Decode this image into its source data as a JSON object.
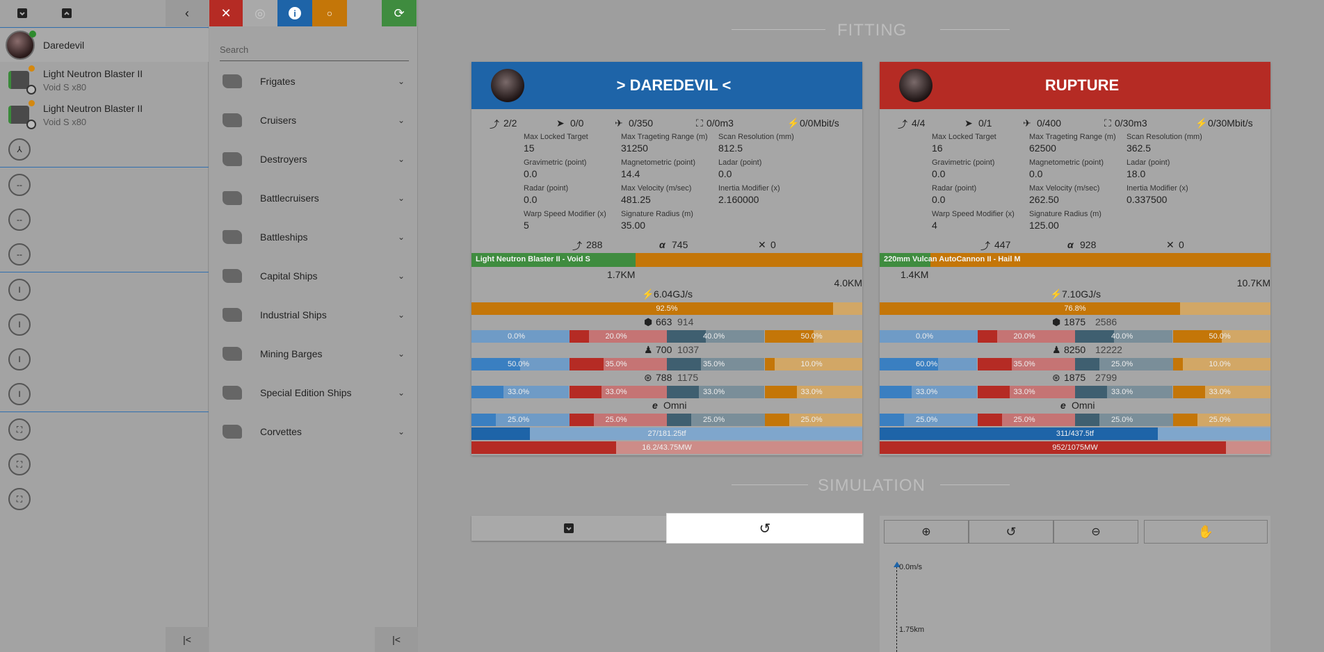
{
  "left": {
    "top_buttons": [
      "archive-down",
      "archive-up",
      "collapse"
    ],
    "ship": {
      "name": "Daredevil"
    },
    "modules": [
      {
        "name": "Light Neutron Blaster II",
        "ammo": "Void S x80"
      },
      {
        "name": "Light Neutron Blaster II",
        "ammo": "Void S x80"
      }
    ],
    "high_empty_symbol": "⅄",
    "mid_slots": [
      "--",
      "--",
      "--"
    ],
    "low_slots": [
      "I",
      "I",
      "I",
      "I"
    ],
    "rig_slots": [
      "⛶",
      "⛶",
      "⛶"
    ],
    "footer_icon": "|<"
  },
  "middle": {
    "search_placeholder": "Search",
    "categories": [
      "Frigates",
      "Cruisers",
      "Destroyers",
      "Battlecruisers",
      "Battleships",
      "Capital Ships",
      "Industrial Ships",
      "Mining Barges",
      "Special Edition Ships",
      "Corvettes"
    ],
    "footer_icon": "|<"
  },
  "main": {
    "fitting_title": "FITTING",
    "simulation_title": "SIMULATION",
    "colors": {
      "blue": "#1e64a8",
      "red": "#b52b24",
      "orange": "#c47608",
      "green": "#3f8c3f"
    },
    "ships": [
      {
        "title": "> DAREDEVIL <",
        "head_color": "#1e64a8",
        "resources": {
          "turrets": "2/2",
          "launchers": "0/0",
          "drone_bay": "0/350",
          "drone_cap": "0/0m3",
          "bandwidth": "0/0Mbit/s"
        },
        "stats": [
          {
            "label": "Max Locked Target",
            "value": "15"
          },
          {
            "label": "Max Trageting Range (m)",
            "value": "31250"
          },
          {
            "label": "Scan Resolution (mm)",
            "value": "812.5"
          },
          {
            "label": "Gravimetric (point)",
            "value": "0.0"
          },
          {
            "label": "Magnetometric (point)",
            "value": "14.4"
          },
          {
            "label": "Ladar (point)",
            "value": "0.0"
          },
          {
            "label": "Radar (point)",
            "value": "0.0"
          },
          {
            "label": "Max Velocity (m/sec)",
            "value": "481.25"
          },
          {
            "label": "Inertia Modifier (x)",
            "value": "2.160000"
          },
          {
            "label": "Warp Speed Modifier (x)",
            "value": "5"
          },
          {
            "label": "Signature Radius (m)",
            "value": "35.00"
          }
        ],
        "dps": {
          "weapon": "288",
          "alpha": "745",
          "other": "0"
        },
        "weapon_bar": {
          "label": "Light Neutron Blaster II - Void S",
          "fraction": 0.42
        },
        "optimal": "1.7KM",
        "falloff": "4.0KM",
        "cap": {
          "rate": "6.04GJ/s",
          "pct": "92.5%",
          "fraction": 0.925
        },
        "shield": {
          "hp": "663",
          "ehp": "914",
          "resists": [
            "0.0%",
            "20.0%",
            "40.0%",
            "50.0%"
          ]
        },
        "armor": {
          "hp": "700",
          "ehp": "1037",
          "resists": [
            "50.0%",
            "35.0%",
            "35.0%",
            "10.0%"
          ]
        },
        "hull": {
          "hp": "788",
          "ehp": "1175",
          "resists": [
            "33.0%",
            "33.0%",
            "33.0%",
            "33.0%"
          ]
        },
        "profile": {
          "label": "Omni",
          "resists": [
            "25.0%",
            "25.0%",
            "25.0%",
            "25.0%"
          ]
        },
        "cpu": {
          "label": "27/181.25tf",
          "fraction": 0.149
        },
        "power": {
          "label": "16.2/43.75MW",
          "fraction": 0.37
        }
      },
      {
        "title": "RUPTURE",
        "head_color": "#b52b24",
        "resources": {
          "turrets": "4/4",
          "launchers": "0/1",
          "drone_bay": "0/400",
          "drone_cap": "0/30m3",
          "bandwidth": "0/30Mbit/s"
        },
        "stats": [
          {
            "label": "Max Locked Target",
            "value": "16"
          },
          {
            "label": "Max Trageting Range (m)",
            "value": "62500"
          },
          {
            "label": "Scan Resolution (mm)",
            "value": "362.5"
          },
          {
            "label": "Gravimetric (point)",
            "value": "0.0"
          },
          {
            "label": "Magnetometric (point)",
            "value": "0.0"
          },
          {
            "label": "Ladar (point)",
            "value": "18.0"
          },
          {
            "label": "Radar (point)",
            "value": "0.0"
          },
          {
            "label": "Max Velocity (m/sec)",
            "value": "262.50"
          },
          {
            "label": "Inertia Modifier (x)",
            "value": "0.337500"
          },
          {
            "label": "Warp Speed Modifier (x)",
            "value": "4"
          },
          {
            "label": "Signature Radius (m)",
            "value": "125.00"
          }
        ],
        "dps": {
          "weapon": "447",
          "alpha": "928",
          "other": "0"
        },
        "weapon_bar": {
          "label": "220mm Vulcan AutoCannon II - Hail M",
          "fraction": 0.13
        },
        "optimal": "1.4KM",
        "falloff": "10.7KM",
        "cap": {
          "rate": "7.10GJ/s",
          "pct": "76.8%",
          "fraction": 0.768
        },
        "shield": {
          "hp": "1875",
          "ehp": "2586",
          "resists": [
            "0.0%",
            "20.0%",
            "40.0%",
            "50.0%"
          ]
        },
        "armor": {
          "hp": "8250",
          "ehp": "12222",
          "resists": [
            "60.0%",
            "35.0%",
            "25.0%",
            "10.0%"
          ]
        },
        "hull": {
          "hp": "1875",
          "ehp": "2799",
          "resists": [
            "33.0%",
            "33.0%",
            "33.0%",
            "33.0%"
          ]
        },
        "profile": {
          "label": "Omni",
          "resists": [
            "25.0%",
            "25.0%",
            "25.0%",
            "25.0%"
          ]
        },
        "cpu": {
          "label": "311/437.5tf",
          "fraction": 0.711
        },
        "power": {
          "label": "952/1075MW",
          "fraction": 0.886
        }
      }
    ],
    "sim": {
      "speed_label": "0.0m/s",
      "dist_label": "1.75km"
    }
  }
}
